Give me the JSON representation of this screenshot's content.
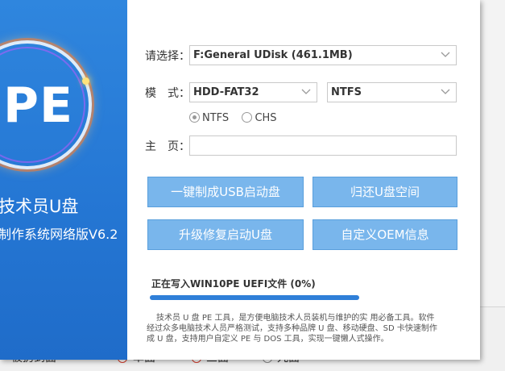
{
  "left_panel": {
    "logo_text": "PE",
    "brand_title": "技术员U盘",
    "brand_sub": "制作系统网络版V6.2"
  },
  "form": {
    "select_label": "请选择：",
    "select_value": "F:General UDisk (461.1MB)",
    "mode_label": "模　式：",
    "mode_value": "HDD-FAT32",
    "fs_value": "NTFS",
    "radio_ntfs": "NTFS",
    "radio_chs": "CHS",
    "radio_selected": "NTFS",
    "home_label": "主　页：",
    "home_value": ""
  },
  "buttons": {
    "make_usb": "一键制成USB启动盘",
    "restore_space": "归还U盘空间",
    "upgrade_repair": "升级修复启动U盘",
    "custom_oem": "自定义OEM信息"
  },
  "progress": {
    "label": "正在写入WIN10PE UEFI文件 (0%)",
    "fill_fraction": 1.0,
    "color": "#2f7fd8"
  },
  "description": {
    "line1": "技术员 U 盘 PE 工具，是方便电脑技术人员装机与维护的实 用必备工具。软件",
    "line2": "经过众多电脑技术人员严格测试，支持多种品牌 U 盘、移动硬盘、SD 卡快速制作",
    "line3": "成 U 盘，支持用户自定义 PE 与 DOS 工具，实现一键懒人式操作。"
  },
  "background_app": {
    "item1": "被扔到面",
    "item2": "单面",
    "item3": "三面",
    "item4": "九面"
  },
  "colors": {
    "accent": "#2577d4",
    "button": "#79b6ec"
  }
}
